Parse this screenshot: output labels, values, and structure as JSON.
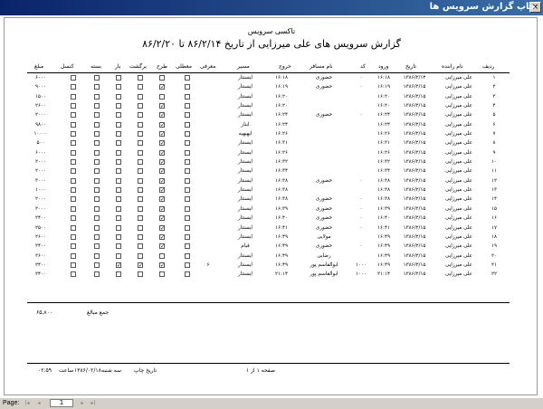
{
  "window": {
    "title": "چاپ گزارش سرویس ها",
    "close_glyph": "×"
  },
  "report": {
    "company": "تاکسی سرویس",
    "title": "گزارش سرویس های علی میرزایی از تاریخ ۸۶/۲/۱۴ تا ۸۶/۲/۲۰",
    "headers": {
      "row_no": "ردیف",
      "driver": "نام راننده",
      "date": "تاریخ",
      "enter": "ورود",
      "code": "کد",
      "passenger": "نام مسافر",
      "exit": "خروج",
      "dest": "مسیر",
      "intro": "معرفی",
      "waiting": "معطلی",
      "trip": "طرح",
      "return": "برگشت",
      "load": "بار",
      "pack": "بسته",
      "cancel": "کنسل",
      "amount": "مبلغ"
    },
    "rows": [
      {
        "no": "۱",
        "driver": "علی میرزایی",
        "date": "۱۳۸۶/۲/۱۴",
        "enter": "۱۶:۱۸",
        "code": "۰",
        "passenger": "حضوری",
        "exit": "۱۶:۱۸",
        "dest": "ایسنتار",
        "intro": "",
        "waiting": false,
        "trip": false,
        "return": false,
        "load": false,
        "pack": false,
        "cancel": false,
        "amount": "۶۰۰۰"
      },
      {
        "no": "۲",
        "driver": "علی میرزایی",
        "date": "۱۳۸۶/۲/۱۵",
        "enter": "۱۶:۱۹",
        "code": "۰",
        "passenger": "حضوری",
        "exit": "۱۶:۱۹",
        "dest": "ایسنتار",
        "intro": "",
        "waiting": false,
        "trip": true,
        "return": false,
        "load": false,
        "pack": false,
        "cancel": false,
        "amount": "۹۰۰۰"
      },
      {
        "no": "۳",
        "driver": "علی میرزایی",
        "date": "۱۳۸۶/۲/۱۵",
        "enter": "۱۶:۲۰",
        "code": "",
        "passenger": "",
        "exit": "۱۶:۲۰",
        "dest": "ایسنتار",
        "intro": "",
        "waiting": false,
        "trip": false,
        "return": false,
        "load": false,
        "pack": false,
        "cancel": false,
        "amount": "۱۵۰۰"
      },
      {
        "no": "۴",
        "driver": "علی میرزایی",
        "date": "۱۳۸۶/۲/۱۵",
        "enter": "۱۶:۲۰",
        "code": "",
        "passenger": "",
        "exit": "۱۶:۲۰",
        "dest": "ایسنتار",
        "intro": "",
        "waiting": false,
        "trip": true,
        "return": false,
        "load": false,
        "pack": false,
        "cancel": false,
        "amount": "۲۶۰۰"
      },
      {
        "no": "۵",
        "driver": "علی میرزایی",
        "date": "۱۳۸۶/۲/۱۵",
        "enter": "۱۶:۲۴",
        "code": "۰",
        "passenger": "حضوری",
        "exit": "۱۶:۲۴",
        "dest": "ایسنتار",
        "intro": "",
        "waiting": false,
        "trip": true,
        "return": false,
        "load": false,
        "pack": false,
        "cancel": false,
        "amount": "۲۰۰۰"
      },
      {
        "no": "۶",
        "driver": "علی میرزایی",
        "date": "۱۳۸۶/۲/۱۵",
        "enter": "۱۶:۲۴",
        "code": "",
        "passenger": "",
        "exit": "۱۶:۲۴",
        "dest": "ابنار",
        "intro": "",
        "waiting": false,
        "trip": true,
        "return": false,
        "load": false,
        "pack": false,
        "cancel": false,
        "amount": "۹۸۰۰"
      },
      {
        "no": "۷",
        "driver": "علی میرزایی",
        "date": "۱۳۸۶/۲/۱۵",
        "enter": "۱۶:۲۶",
        "code": "",
        "passenger": "",
        "exit": "۱۶:۲۶",
        "dest": "ایهیهیه",
        "intro": "",
        "waiting": false,
        "trip": true,
        "return": false,
        "load": false,
        "pack": false,
        "cancel": false,
        "amount": "۱۰۰۰۰"
      },
      {
        "no": "۸",
        "driver": "علی میرزایی",
        "date": "۱۳۸۶/۲/۱۵",
        "enter": "۱۶:۳۱",
        "code": "",
        "passenger": "",
        "exit": "۱۶:۳۱",
        "dest": "ایسنتار",
        "intro": "",
        "waiting": false,
        "trip": true,
        "return": false,
        "load": false,
        "pack": false,
        "cancel": false,
        "amount": "۵۰۰"
      },
      {
        "no": "۹",
        "driver": "علی میرزایی",
        "date": "۱۳۸۶/۲/۱۵",
        "enter": "۱۶:۲۶",
        "code": "",
        "passenger": "",
        "exit": "۱۶:۲۶",
        "dest": "ایسنتار",
        "intro": "",
        "waiting": false,
        "trip": true,
        "return": false,
        "load": false,
        "pack": false,
        "cancel": false,
        "amount": "۶۰۰۰"
      },
      {
        "no": "۱۰",
        "driver": "علی میرزایی",
        "date": "۱۳۸۶/۲/۱۵",
        "enter": "۱۶:۳۲",
        "code": "",
        "passenger": "",
        "exit": "۱۶:۳۲",
        "dest": "ایسنتار",
        "intro": "",
        "waiting": false,
        "trip": true,
        "return": false,
        "load": false,
        "pack": false,
        "cancel": false,
        "amount": "۲۰۰۰"
      },
      {
        "no": "۱۱",
        "driver": "علی میرزایی",
        "date": "۱۳۸۶/۲/۱۵",
        "enter": "۱۶:۳۴",
        "code": "",
        "passenger": "",
        "exit": "۱۶:۳۴",
        "dest": "ایسنتار",
        "intro": "",
        "waiting": false,
        "trip": true,
        "return": false,
        "load": false,
        "pack": false,
        "cancel": false,
        "amount": "۲۰۰۰"
      },
      {
        "no": "۱۲",
        "driver": "علی میرزایی",
        "date": "۱۳۸۶/۲/۱۵",
        "enter": "۱۶:۳۸",
        "code": "۰",
        "passenger": "حضوری",
        "exit": "۱۶:۳۸",
        "dest": "ایسنتار",
        "intro": "",
        "waiting": false,
        "trip": true,
        "return": false,
        "load": false,
        "pack": false,
        "cancel": false,
        "amount": "۳۰۰۰"
      },
      {
        "no": "۱۳",
        "driver": "علی میرزایی",
        "date": "۱۳۸۶/۲/۱۵",
        "enter": "۱۶:۳۸",
        "code": "",
        "passenger": "",
        "exit": "۱۶:۳۸",
        "dest": "ایسنتار",
        "intro": "",
        "waiting": false,
        "trip": true,
        "return": false,
        "load": false,
        "pack": false,
        "cancel": false,
        "amount": "۱۰۰۰"
      },
      {
        "no": "۱۴",
        "driver": "علی میرزایی",
        "date": "۱۳۸۶/۲/۱۵",
        "enter": "۱۶:۳۸",
        "code": "۰",
        "passenger": "حضوری",
        "exit": "۱۶:۳۸",
        "dest": "ایسنتار",
        "intro": "",
        "waiting": false,
        "trip": true,
        "return": false,
        "load": false,
        "pack": false,
        "cancel": false,
        "amount": "۲۰۰۰"
      },
      {
        "no": "۱۵",
        "driver": "علی میرزایی",
        "date": "۱۳۸۶/۲/۱۵",
        "enter": "۱۶:۳۹",
        "code": "۰",
        "passenger": "حضوری",
        "exit": "۱۶:۳۹",
        "dest": "ایسنتار",
        "intro": "",
        "waiting": false,
        "trip": true,
        "return": false,
        "load": false,
        "pack": false,
        "cancel": false,
        "amount": "۲۰۰۰"
      },
      {
        "no": "۱۶",
        "driver": "علی میرزایی",
        "date": "۱۳۸۶/۲/۱۵",
        "enter": "۱۶:۴۰",
        "code": "۰",
        "passenger": "حضوری",
        "exit": "۱۶:۴۰",
        "dest": "ایسنتار",
        "intro": "",
        "waiting": false,
        "trip": true,
        "return": false,
        "load": false,
        "pack": false,
        "cancel": false,
        "amount": "۲۴۰۰"
      },
      {
        "no": "۱۷",
        "driver": "علی میرزایی",
        "date": "۱۳۸۶/۲/۱۵",
        "enter": "۱۶:۴۱",
        "code": "۰",
        "passenger": "حضوری",
        "exit": "۱۶:۴۱",
        "dest": "ایسنتار",
        "intro": "",
        "waiting": false,
        "trip": true,
        "return": false,
        "load": false,
        "pack": false,
        "cancel": false,
        "amount": "۲۵۰۰"
      },
      {
        "no": "۱۸",
        "driver": "علی میرزایی",
        "date": "۱۳۸۶/۲/۱۵",
        "enter": "۱۶:۴۹",
        "code": "",
        "passenger": "مولایی",
        "exit": "۱۶:۴۹",
        "dest": "ایسنتار",
        "intro": "",
        "waiting": false,
        "trip": true,
        "return": false,
        "load": false,
        "pack": false,
        "cancel": false,
        "amount": "۲۶۰۰"
      },
      {
        "no": "۱۹",
        "driver": "علی میرزایی",
        "date": "۱۳۸۶/۲/۱۵",
        "enter": "۱۶:۴۹",
        "code": "۰",
        "passenger": "حضوری",
        "exit": "۱۶:۴۹",
        "dest": "قیام",
        "intro": "",
        "waiting": false,
        "trip": true,
        "return": false,
        "load": false,
        "pack": false,
        "cancel": false,
        "amount": "۲۴۰۰"
      },
      {
        "no": "۲۰",
        "driver": "علی میرزایی",
        "date": "۱۳۸۶/۲/۱۵",
        "enter": "۱۶:۴۹",
        "code": "",
        "passenger": "رضایی",
        "exit": "۱۶:۴۹",
        "dest": "ایسنتار",
        "intro": "",
        "waiting": false,
        "trip": false,
        "return": false,
        "load": false,
        "pack": false,
        "cancel": false,
        "amount": "۲۶۰۰"
      },
      {
        "no": "۲۱",
        "driver": "علی میرزایی",
        "date": "۱۳۸۶/۲/۱۵",
        "enter": "۱۶:۴۹",
        "code": "۱۰۰۰",
        "passenger": "ابوالقاسم پور",
        "exit": "۱۶:۴۹",
        "dest": "ایسنتار",
        "intro": "۶",
        "waiting": false,
        "trip": true,
        "return": true,
        "load": true,
        "pack": false,
        "cancel": false,
        "amount": "۲۴۰۰"
      },
      {
        "no": "۲۲",
        "driver": "علی میرزایی",
        "date": "۱۳۸۶/۲/۱۵",
        "enter": "۲۱:۱۴",
        "code": "۱۰۰۰",
        "passenger": "ابوالقاسم پور",
        "exit": "۲۱:۱۴",
        "dest": "ایسنتار",
        "intro": "",
        "waiting": false,
        "trip": false,
        "return": false,
        "load": false,
        "pack": false,
        "cancel": false,
        "amount": "۲۴۰۰"
      }
    ],
    "total_label": "جمع مبالغ",
    "total_value": "۶۵,۸۰۰",
    "footer": {
      "print_date_label": "تاریخ چاپ",
      "print_day": "سه شنبه",
      "print_date": "۱۳۸۶/۰۲/۱۸",
      "time_label": "ساعت",
      "print_time": "۰۲:۵۹",
      "page_text": "صفحه ۱ از ۱"
    }
  },
  "statusbar": {
    "page_label": "Page:",
    "page_value": "1",
    "nav_first": "|◂",
    "nav_prev": "◂",
    "nav_next": "▸",
    "nav_last": "▸|",
    "checkmark": "✓"
  }
}
